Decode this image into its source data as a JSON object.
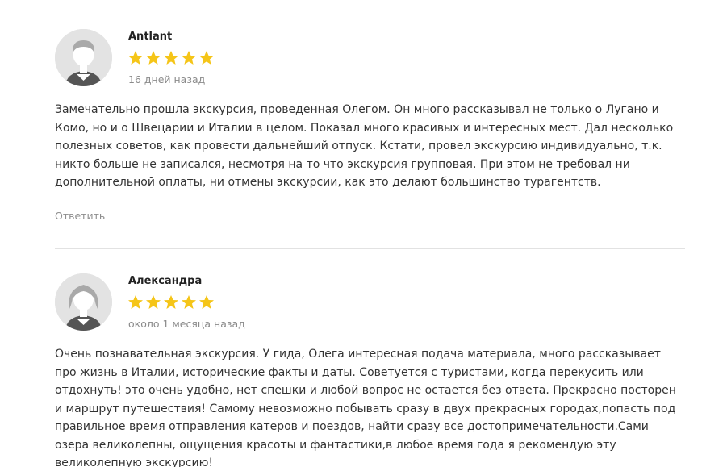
{
  "colors": {
    "star": "#f5c518",
    "divider": "#e2e2e2",
    "muted": "#8a8a8a"
  },
  "reviews": [
    {
      "author": "Antlant",
      "rating": 5,
      "date": "16 дней назад",
      "avatar_icon": "user-avatar-male-icon",
      "text": "Замечательно прошла экскурсия, проведенная Олегом. Он много рассказывал не только о Лугано и Комо, но и о Швецарии и Италии в целом. Показал много красивых и интересных мест. Дал несколько полезных советов, как провести дальнейший отпуск. Кстати, провел экскурсию индивидуально, т.к. никто больше не записался, несмотря на то что экскурсия групповая. При этом не требовал ни дополнительной оплаты, ни отмены экскурсии, как это делают большинство турагентств.",
      "reply_label": "Ответить"
    },
    {
      "author": "Александра",
      "rating": 5,
      "date": "около 1 месяца назад",
      "avatar_icon": "user-avatar-female-icon",
      "text": "Очень познавательная экскурсия. У гида, Олега интересная подача материала, много рассказывает про жизнь в Италии, исторические факты и даты. Советуется с туристами, когда перекусить или отдохнуть! это очень удобно, нет спешки и любой вопрос не остается без ответа. Прекрасно посторен и маршрут путешествия! Самому невозможно побывать сразу в двух прекрасных городах,попаcть под правильное время отправления катеров и поездов, найти сразу все достопримечательности.Сами озера великолепны, ощущения красоты и фантастики,в любое время года я рекомендую эту великолепную экскурсию!"
    }
  ]
}
